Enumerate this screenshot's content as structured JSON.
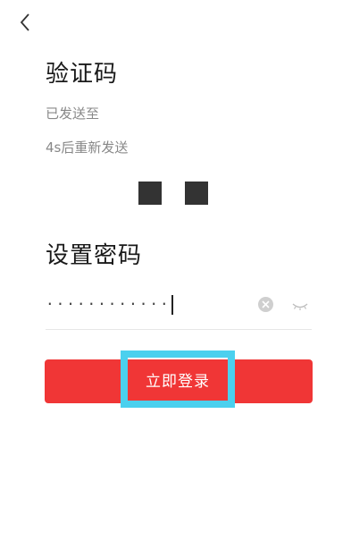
{
  "header": {
    "back_icon": "chevron-left-icon"
  },
  "verify": {
    "title": "验证码",
    "sent_to_label": "已发送至",
    "resend_text": "4s后重新发送",
    "code_boxes": 2
  },
  "password": {
    "title": "设置密码",
    "value": "············",
    "clear_icon": "clear-circle-icon",
    "visibility_icon": "eye-closed-icon"
  },
  "login": {
    "label": "立即登录",
    "color": "#f03636",
    "highlight_color": "#4bd0ee"
  }
}
